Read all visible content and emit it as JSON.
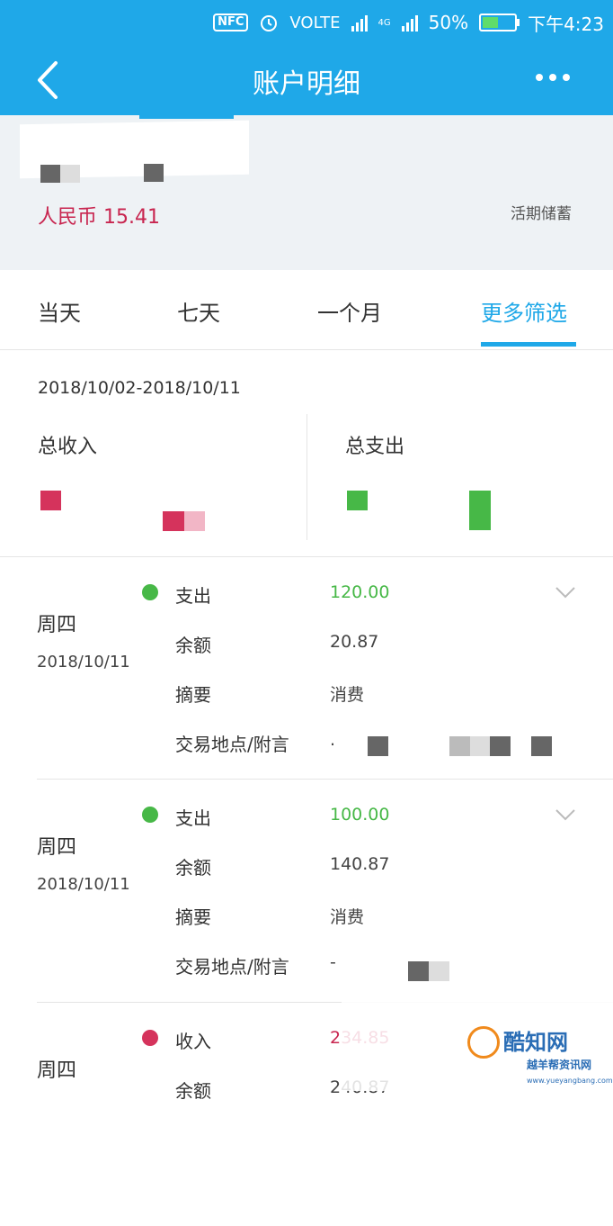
{
  "status_bar": {
    "nfc": "NFC",
    "volte": "VOLTE",
    "network": "4G",
    "battery": "50%",
    "battery_level": 0.5,
    "time": "下午4:23"
  },
  "header": {
    "title": "账户明细"
  },
  "account": {
    "balance": "人民币 15.41",
    "type": "活期储蓄"
  },
  "tabs": [
    {
      "label": "当天"
    },
    {
      "label": "七天"
    },
    {
      "label": "一个月"
    },
    {
      "label": "更多筛选",
      "active": true
    }
  ],
  "summary": {
    "date_range": "2018/10/02-2018/10/11",
    "income_label": "总收入",
    "expense_label": "总支出"
  },
  "colors": {
    "brand": "#1fa8e8",
    "income": "#c8254f",
    "expense": "#47b847"
  },
  "transactions": [
    {
      "weekday": "周四",
      "date": "2018/10/11",
      "kind": "out",
      "type_label": "支出",
      "amount": "120.00",
      "balance_label": "余额",
      "balance": "20.87",
      "memo_label": "摘要",
      "memo": "消费",
      "place_label": "交易地点/附言",
      "place": "."
    },
    {
      "weekday": "周四",
      "date": "2018/10/11",
      "kind": "out",
      "type_label": "支出",
      "amount": "100.00",
      "balance_label": "余额",
      "balance": "140.87",
      "memo_label": "摘要",
      "memo": "消费",
      "place_label": "交易地点/附言",
      "place": "-"
    },
    {
      "weekday": "周四",
      "kind": "in",
      "type_label": "收入",
      "amount": "234.85",
      "balance_label": "余额",
      "balance": "240.87"
    }
  ],
  "watermark": {
    "name": "酷知网",
    "sub": "越羊帮资讯网",
    "url": "www.yueyangbang.com"
  }
}
